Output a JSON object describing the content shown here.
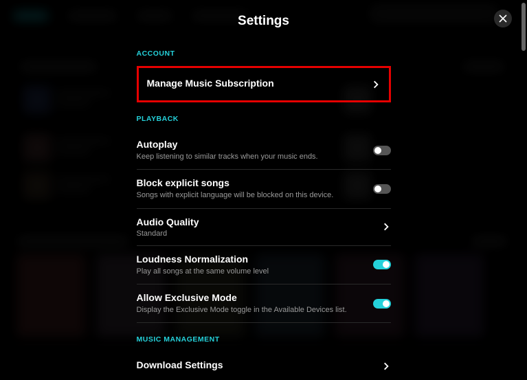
{
  "title": "Settings",
  "sections": {
    "account": {
      "header": "ACCOUNT",
      "manage_sub": {
        "label": "Manage Music Subscription"
      }
    },
    "playback": {
      "header": "PLAYBACK",
      "autoplay": {
        "label": "Autoplay",
        "desc": "Keep listening to similar tracks when your music ends.",
        "on": false
      },
      "block_explicit": {
        "label": "Block explicit songs",
        "desc": "Songs with explicit language will be blocked on this device.",
        "on": false
      },
      "audio_quality": {
        "label": "Audio Quality",
        "value": "Standard"
      },
      "loudness": {
        "label": "Loudness Normalization",
        "desc": "Play all songs at the same volume level",
        "on": true
      },
      "exclusive": {
        "label": "Allow Exclusive Mode",
        "desc": "Display the Exclusive Mode toggle in the Available Devices list.",
        "on": true
      }
    },
    "music_mgmt": {
      "header": "MUSIC MANAGEMENT",
      "download": {
        "label": "Download Settings"
      }
    }
  },
  "colors": {
    "accent": "#25d1da",
    "highlight": "#e60000"
  }
}
